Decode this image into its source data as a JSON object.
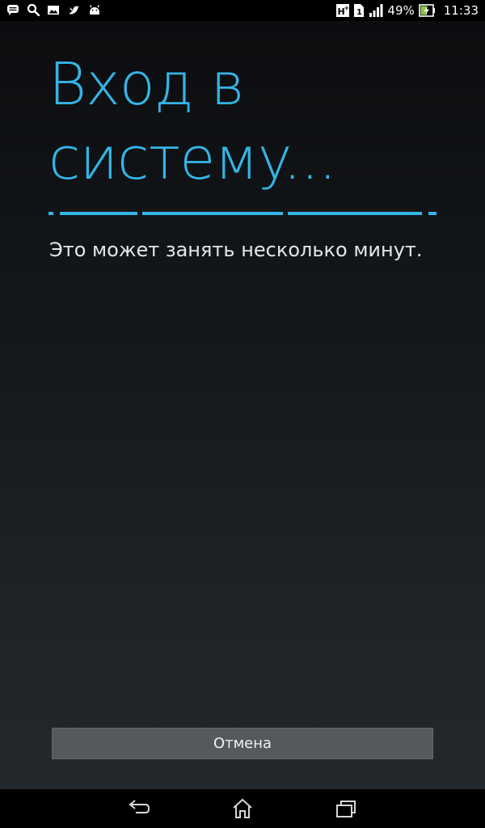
{
  "status_bar": {
    "notification_icons": [
      "message-icon",
      "search-icon",
      "gallery-icon",
      "bird-icon",
      "android-icon"
    ],
    "network_type": "H+",
    "sim_slot": "1",
    "signal": "signal-icon",
    "battery_percent": "49%",
    "battery_state": "charging",
    "time": "11:33"
  },
  "main": {
    "title": "Вход в системy...",
    "subtitle": "Это может занять несколько минут.",
    "progress_color": "#33b5e5",
    "indeterminate": true
  },
  "actions": {
    "cancel_label": "Отмена"
  },
  "nav_bar": {
    "buttons": [
      "back-icon",
      "home-icon",
      "recent-apps-icon"
    ]
  },
  "colors": {
    "accent": "#33b5e5",
    "button_bg": "#55595c",
    "text": "#e6e6e6"
  }
}
